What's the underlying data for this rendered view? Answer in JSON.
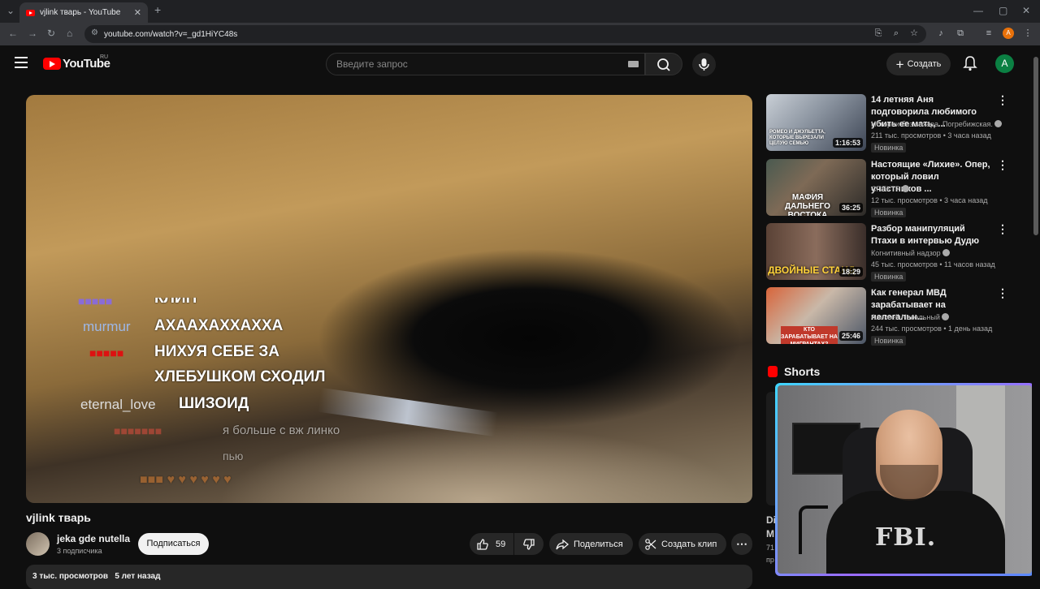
{
  "browser": {
    "tab_title": "vjlink тварь - YouTube",
    "url": "youtube.com/watch?v=_gd1HiYC48s",
    "new_tab": "+"
  },
  "header": {
    "logo_text": "YouTube",
    "country": "RU",
    "search_placeholder": "Введите запрос",
    "create_label": "Создать",
    "avatar_letter": "A"
  },
  "player": {
    "chat": [
      {
        "user": "",
        "text": "КЛИП"
      },
      {
        "user": "murmur",
        "text": "АХААХАХХАХХА"
      },
      {
        "user": "",
        "text": "НИХУЯ СЕБЕ ЗА"
      },
      {
        "user": "",
        "text": "ХЛЕБУШКОМ СХОДИЛ"
      },
      {
        "user": "eternal_love",
        "text": "ШИЗОИД"
      },
      {
        "user": "",
        "text": "я больше с вж линко"
      },
      {
        "user": "",
        "text": "пью"
      }
    ]
  },
  "video": {
    "title": "vjlink тварь",
    "channel": "jeka gde nutella",
    "subscribers": "3 подписчика",
    "subscribe_label": "Подписаться",
    "likes": "59",
    "share_label": "Поделиться",
    "clip_label": "Создать клип",
    "views": "3 тыс. просмотров",
    "age": "5 лет назад"
  },
  "recommendations": [
    {
      "title": "14 летняя Аня подговорила любимого убить ее мать, ...",
      "channel": "Истории без сахара. Погребижская.",
      "meta": "211 тыс. просмотров • 3 часа назад",
      "badge": "Новинка",
      "duration": "1:16:53",
      "thumb_text": "РОМЕО И ДЖУЛЬЕТТА, КОТОРЫЕ ВЫРЕЗАЛИ ЦЕЛУЮ СЕМЬЮ"
    },
    {
      "title": "Настоящие «Лихие». Опер, который ловил участников ...",
      "channel": "СПЕКТР",
      "meta": "12 тыс. просмотров • 3 часа назад",
      "badge": "Новинка",
      "duration": "36:25",
      "thumb_text": "МАФИЯ ДАЛЬНЕГО ВОСТОКА"
    },
    {
      "title": "Разбор манипуляций Птахи в интервью Дудю",
      "channel": "Когнитивный надзор",
      "meta": "45 тыс. просмотров • 11 часов назад",
      "badge": "Новинка",
      "duration": "18:29",
      "thumb_text": "ДВОЙНЫЕ СТАНД"
    },
    {
      "title": "Как генерал МВД зарабатывает на нелегальн...",
      "channel": "Алексей Навальный",
      "meta": "244 тыс. просмотров • 1 день назад",
      "badge": "Новинка",
      "duration": "25:46",
      "thumb_text": "КТО ЗАРАБАТЫВАЕТ НА МИГРАНТАХ?"
    }
  ],
  "shorts": {
    "title": "Shorts",
    "peek_lines": [
      "Di",
      "M",
      "71",
      "пр"
    ]
  },
  "webcam": {
    "shirt_text": "FBI."
  },
  "colors": {
    "bg": "#0f0f0f",
    "brand_red": "#ff0000",
    "avatar_green": "#0b8043",
    "webcam_frame": "#3fd6ff"
  }
}
